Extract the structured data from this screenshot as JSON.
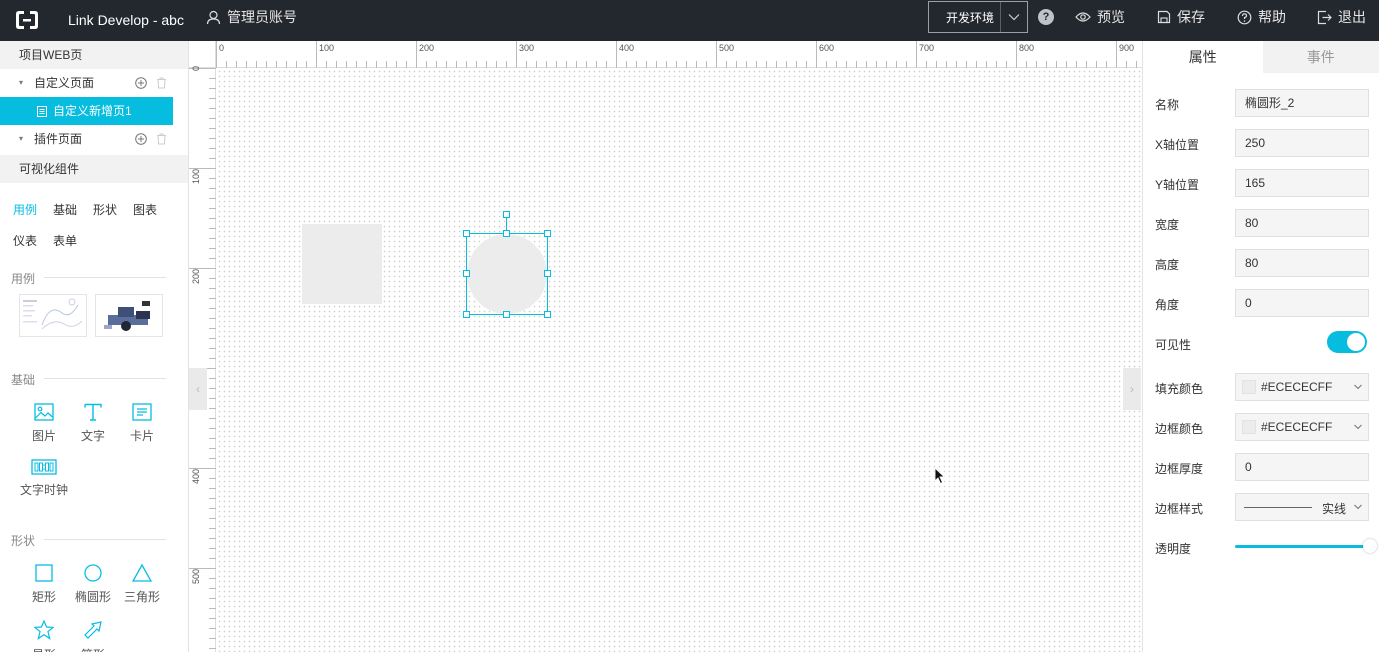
{
  "topbar": {
    "title": "Link Develop - abc",
    "account": "管理员账号",
    "env": "开发环境",
    "help_q": "?",
    "preview": "预览",
    "save": "保存",
    "help": "帮助",
    "logout": "退出"
  },
  "sidebar": {
    "project_section": "项目WEB页",
    "custom_pages": "自定义页面",
    "custom_page_item": "自定义新增页1",
    "plugin_pages": "插件页面",
    "components_section": "可视化组件",
    "tabs": [
      "用例",
      "基础",
      "形状",
      "图表",
      "仪表",
      "表单"
    ],
    "active_tab": "用例",
    "groups": {
      "examples": "用例",
      "basic": "基础",
      "shapes": "形状"
    },
    "basic_items": [
      "图片",
      "文字",
      "卡片",
      "文字时钟"
    ],
    "shape_items": [
      "矩形",
      "椭圆形",
      "三角形",
      "星形",
      "箭形"
    ]
  },
  "ruler": {
    "top": [
      "0",
      "100",
      "200",
      "300",
      "400",
      "500",
      "600",
      "700",
      "800",
      "900"
    ],
    "left": [
      "0",
      "100",
      "200",
      "400",
      "500"
    ]
  },
  "panel": {
    "tab_props": "属性",
    "tab_events": "事件",
    "name_label": "名称",
    "name_value": "椭圆形_2",
    "x_label": "X轴位置",
    "x_value": "250",
    "y_label": "Y轴位置",
    "y_value": "165",
    "w_label": "宽度",
    "w_value": "80",
    "h_label": "高度",
    "h_value": "80",
    "angle_label": "角度",
    "angle_value": "0",
    "visible_label": "可见性",
    "visible": true,
    "fill_label": "填充颜色",
    "fill_value": "#ECECECFF",
    "border_color_label": "边框颜色",
    "border_color_value": "#ECECECFF",
    "border_width_label": "边框厚度",
    "border_width_value": "0",
    "border_style_label": "边框样式",
    "border_style_value": "实线",
    "opacity_label": "透明度",
    "opacity": 1.0
  },
  "colors": {
    "accent": "#06bde0",
    "topbar_bg": "#23272e",
    "shape_fill": "#ececec"
  }
}
